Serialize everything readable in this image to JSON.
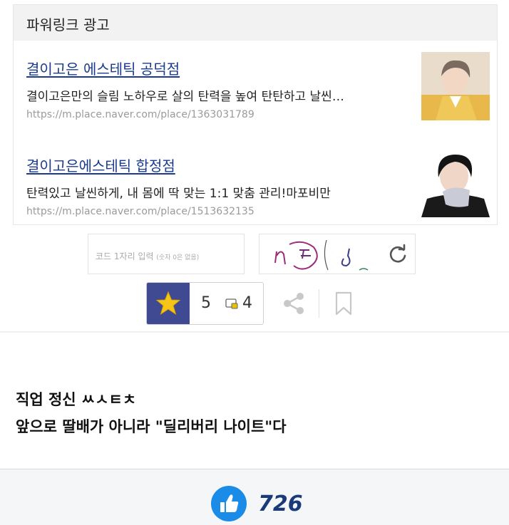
{
  "ad": {
    "header": "파워링크 광고",
    "items": [
      {
        "title": "결이고은 에스테틱 공덕점",
        "desc": "결이고은만의 슬림 노하우로 살의 탄력을 높여 탄탄하고 날씬…",
        "url": "https://m.place.naver.com/place/1363031789"
      },
      {
        "title": "결이고은에스테틱 합정점",
        "desc": "탄력있고 날씬하게, 내 몸에 딱 맞는 1:1 맞춤 관리!마포비만",
        "url": "https://m.place.naver.com/place/1513632135"
      }
    ]
  },
  "captcha": {
    "placeholder_main": "코드 1자리 입력",
    "placeholder_note": "(숫자 0은 없음)",
    "refresh_icon": "refresh-icon"
  },
  "actions": {
    "star_icon": "star-icon",
    "vote_count": "5",
    "comment_count": "4",
    "share_icon": "share-icon",
    "bookmark_icon": "bookmark-icon"
  },
  "post": {
    "line1": "직업 정신 ㅆㅅㅌㅊ",
    "line2": "앞으로 딸배가 아니라 \"딜리버리 나이트\"다"
  },
  "footer": {
    "like_icon": "thumbs-up-icon",
    "like_count": "726"
  },
  "colors": {
    "ad_title": "#1a3a8f",
    "star_bg": "#3f4a93",
    "star": "#f5c518",
    "like_bg": "#1b8be8",
    "like_count": "#1a3a7a"
  }
}
